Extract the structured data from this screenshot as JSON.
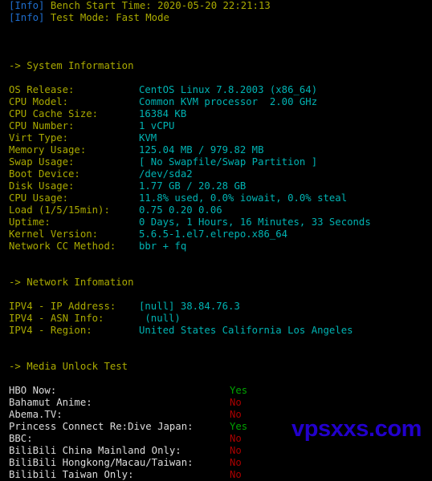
{
  "terminal": {
    "background_color": "#000000",
    "info_tag_color": "#1f6fd0",
    "label_color": "#aaaa00",
    "value_color": "#00b3b3",
    "media_label_color": "#dcdcdc",
    "yes_color": "#00a300",
    "no_color": "#aa0000",
    "watermark_color": "#2200cc"
  },
  "header": {
    "lines": [
      {
        "tag": "[Info]",
        "text": " Bench Start Time: 2020-05-20 22:21:13"
      },
      {
        "tag": "[Info]",
        "text": " Test Mode: Fast Mode"
      }
    ]
  },
  "sections": {
    "system": {
      "heading": "-> System Information",
      "rows": [
        {
          "label": "OS Release:",
          "value": "CentOS Linux 7.8.2003 (x86_64)"
        },
        {
          "label": "CPU Model:",
          "value": "Common KVM processor  2.00 GHz"
        },
        {
          "label": "CPU Cache Size:",
          "value": "16384 KB"
        },
        {
          "label": "CPU Number:",
          "value": "1 vCPU"
        },
        {
          "label": "Virt Type:",
          "value": "KVM"
        },
        {
          "label": "Memory Usage:",
          "value": "125.04 MB / 979.82 MB"
        },
        {
          "label": "Swap Usage:",
          "value": "[ No Swapfile/Swap Partition ]"
        },
        {
          "label": "Boot Device:",
          "value": "/dev/sda2"
        },
        {
          "label": "Disk Usage:",
          "value": "1.77 GB / 20.28 GB"
        },
        {
          "label": "CPU Usage:",
          "value": "11.8% used, 0.0% iowait, 0.0% steal"
        },
        {
          "label": "Load (1/5/15min):",
          "value": "0.75 0.20 0.06"
        },
        {
          "label": "Uptime:",
          "value": "0 Days, 1 Hours, 16 Minutes, 33 Seconds"
        },
        {
          "label": "Kernel Version:",
          "value": "5.6.5-1.el7.elrepo.x86_64"
        },
        {
          "label": "Network CC Method:",
          "value": "bbr + fq"
        }
      ]
    },
    "network": {
      "heading": "-> Network Infomation",
      "rows": [
        {
          "label": "IPV4 - IP Address:",
          "value": "[null] 38.84.76.3"
        },
        {
          "label": "IPV4 - ASN Info:",
          "value": " (null)"
        },
        {
          "label": "IPV4 - Region:",
          "value": "United States California Los Angeles"
        }
      ]
    },
    "media": {
      "heading": "-> Media Unlock Test",
      "rows": [
        {
          "label": "HBO Now:",
          "value": "Yes"
        },
        {
          "label": "Bahamut Anime:",
          "value": "No"
        },
        {
          "label": "Abema.TV:",
          "value": "No"
        },
        {
          "label": "Princess Connect Re:Dive Japan:",
          "value": "Yes"
        },
        {
          "label": "BBC:",
          "value": "No"
        },
        {
          "label": "BiliBili China Mainland Only:",
          "value": "No"
        },
        {
          "label": "BiliBili Hongkong/Macau/Taiwan:",
          "value": "No"
        },
        {
          "label": "Bilibili Taiwan Only:",
          "value": "No"
        }
      ]
    }
  },
  "watermark": {
    "text": "vpsxxs.com"
  }
}
